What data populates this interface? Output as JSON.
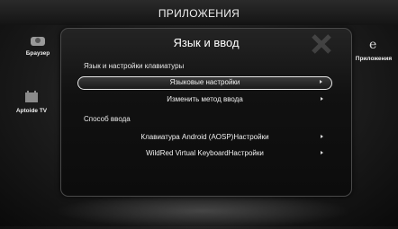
{
  "header": {
    "title": "ПРИЛОЖЕНИЯ"
  },
  "side_tiles": {
    "browser": {
      "label": "Браузер",
      "icon": "browser-icon"
    },
    "aptoide": {
      "label": "Aptoide TV",
      "icon": "aptoide-tv-icon"
    },
    "apps": {
      "label": "Приложения",
      "icon": "apps-icon"
    }
  },
  "dialog": {
    "title": "Язык и ввод",
    "sections": [
      {
        "header": "Язык и настройки клавиатуры",
        "items": [
          {
            "label": "Языковые настройки",
            "selected": true
          },
          {
            "label": "Изменить метод ввода",
            "selected": false
          }
        ]
      },
      {
        "header": "Способ ввода",
        "items": [
          {
            "label": "Клавиатура Android (AOSP)Настройки",
            "selected": false
          },
          {
            "label": "WildRed Virtual KeyboardНастройки",
            "selected": false
          }
        ]
      }
    ]
  },
  "colors": {
    "selection_border": "#e8e8e8",
    "dialog_bg": "#111111",
    "text": "#ffffff"
  }
}
